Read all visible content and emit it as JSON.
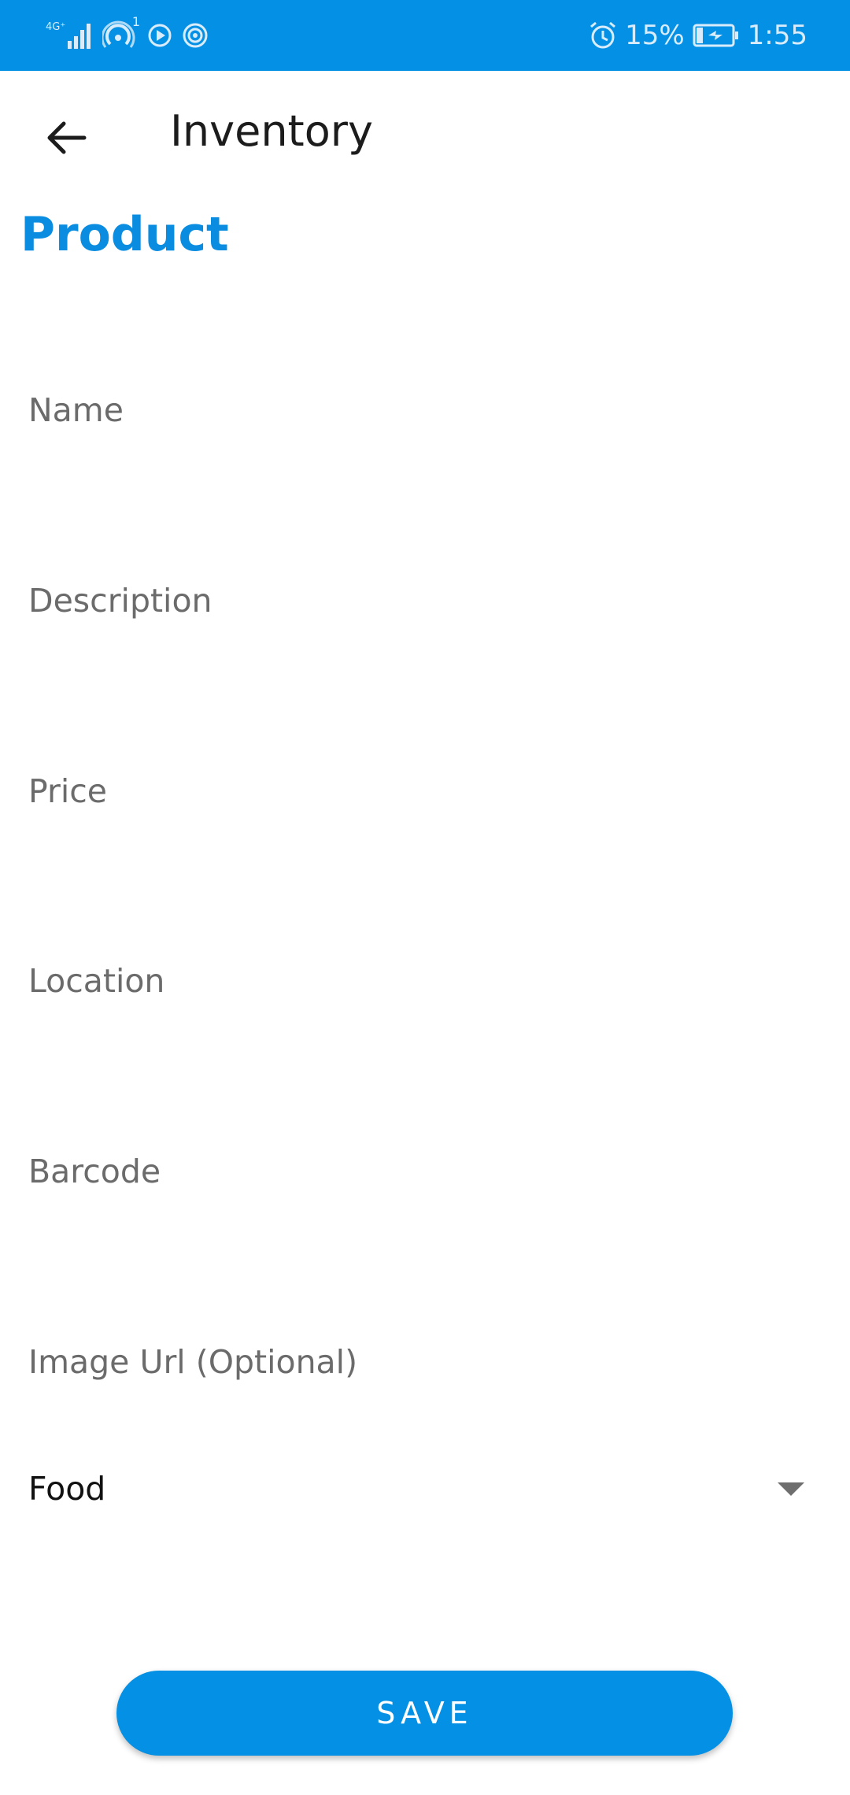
{
  "status_bar": {
    "network": "4G⁺",
    "notification_count": "1",
    "battery_percent": "15%",
    "time": "1:55",
    "icons": [
      "signal-icon",
      "hotspot-icon",
      "play-icon",
      "broadcast-icon",
      "alarm-icon",
      "battery-charging-icon"
    ]
  },
  "app_bar": {
    "title": "Inventory",
    "back_icon": "arrow-left-icon"
  },
  "form": {
    "section_title": "Product",
    "fields": [
      {
        "placeholder": "Name",
        "value": ""
      },
      {
        "placeholder": "Description",
        "value": ""
      },
      {
        "placeholder": "Price",
        "value": ""
      },
      {
        "placeholder": "Location",
        "value": ""
      },
      {
        "placeholder": "Barcode",
        "value": ""
      },
      {
        "placeholder": "Image Url (Optional)",
        "value": ""
      }
    ],
    "category": {
      "selected": "Food",
      "icon": "caret-down-icon"
    },
    "save_label": "SAVE"
  },
  "colors": {
    "primary": "#0490e4",
    "title_blue": "#0a8ce0",
    "placeholder_gray": "#6b6b6b"
  }
}
